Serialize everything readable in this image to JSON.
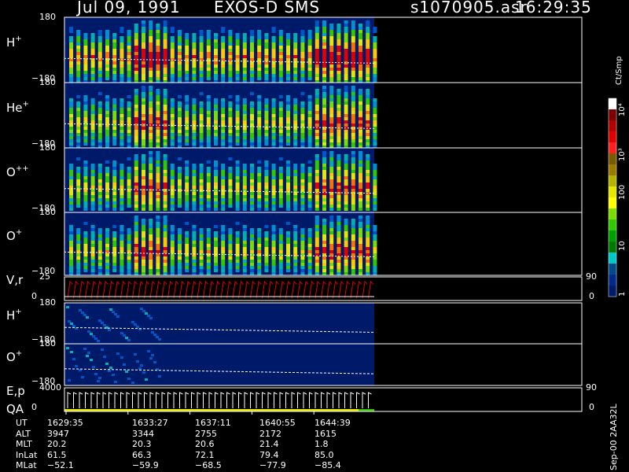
{
  "header": {
    "date": "Jul 09, 1991",
    "mission": "EXOS-D SMS",
    "file": "s1070905.asr",
    "time": "16:29:35"
  },
  "panels": [
    {
      "label": "H",
      "sup": "+",
      "ytop": "180",
      "ybot": "−180"
    },
    {
      "label": "He",
      "sup": "+",
      "ytop": "180",
      "ybot": "−180"
    },
    {
      "label": "O",
      "sup": "++",
      "ytop": "180",
      "ybot": "−180"
    },
    {
      "label": "O",
      "sup": "+",
      "ytop": "180",
      "ybot": "−180"
    },
    {
      "label": "V,r",
      "sup": "",
      "ytop": "25",
      "ybot": "0",
      "right_top": "90",
      "right_bot": "0"
    },
    {
      "label": "H",
      "sup": "+",
      "ytop": "180",
      "ybot": "−180"
    },
    {
      "label": "O",
      "sup": "+",
      "ytop": "180",
      "ybot": "−180"
    },
    {
      "label": "E,p",
      "label2": "QA",
      "sup": "",
      "ytop": "4000",
      "ybot": "0",
      "right_top": "90",
      "right_bot": "0"
    }
  ],
  "colorbar": {
    "unit": "Ct/Smp",
    "labels": [
      "10⁴",
      "10³",
      "100",
      "10",
      "1"
    ],
    "colors": [
      "#ffffff",
      "#7a0000",
      "#b00000",
      "#e00000",
      "#ff2020",
      "#7a5a00",
      "#9a7a00",
      "#b4b400",
      "#e6e600",
      "#ffff00",
      "#7adc00",
      "#30c800",
      "#00a000",
      "#007a00",
      "#00c8c8",
      "#004a8a",
      "#002a8a",
      "#001a6a"
    ]
  },
  "footer_id": "Sep-00 2AA32L",
  "table": {
    "row_labels": [
      "UT",
      "ALT",
      "MLT",
      "InLat",
      "MLat"
    ],
    "columns": [
      [
        "1629:35",
        "3947",
        "20.2",
        "61.5",
        "−52.1"
      ],
      [
        "1633:27",
        "3344",
        "20.3",
        "66.3",
        "−59.9"
      ],
      [
        "1637:11",
        "2755",
        "20.6",
        "72.1",
        "−68.5"
      ],
      [
        "1640:55",
        "2172",
        "21.4",
        "79.4",
        "−77.9"
      ],
      [
        "1644:39",
        "1615",
        "1.8",
        "85.0",
        "−85.4"
      ]
    ]
  },
  "chart_data": {
    "type": "heatmap",
    "title": "Jul 09, 1991   EXOS-D SMS",
    "x_tick_labels": [
      "1629:35",
      "1633:27",
      "1637:11",
      "1640:55",
      "1644:39"
    ],
    "colorscale_unit": "Ct/Smp",
    "colorscale_range": [
      1,
      10000
    ],
    "colorscale_log": true,
    "data_coverage_fraction": 0.6,
    "panels": [
      {
        "species": "H+",
        "ylim": [
          -180,
          180
        ]
      },
      {
        "species": "He+",
        "ylim": [
          -180,
          180
        ]
      },
      {
        "species": "O++",
        "ylim": [
          -180,
          180
        ]
      },
      {
        "species": "O+",
        "ylim": [
          -180,
          180
        ]
      },
      {
        "species": "V,r",
        "ylim": [
          0,
          25
        ],
        "right_ylim": [
          0,
          90
        ]
      },
      {
        "species": "H+",
        "ylim": [
          -180,
          180
        ]
      },
      {
        "species": "O+",
        "ylim": [
          -180,
          180
        ]
      },
      {
        "species": "E,p / QA",
        "ylim": [
          0,
          4000
        ],
        "right_ylim": [
          0,
          90
        ]
      }
    ]
  }
}
